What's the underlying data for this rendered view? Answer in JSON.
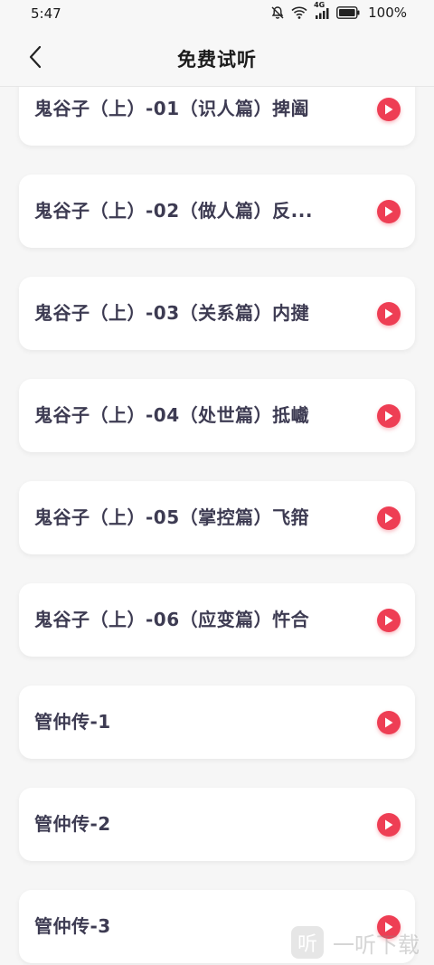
{
  "status_bar": {
    "time": "5:47",
    "network": "4G",
    "battery": "100%"
  },
  "header": {
    "title": "免费试听"
  },
  "episodes": [
    {
      "title": "鬼谷子（上）-01（识人篇）捭阖"
    },
    {
      "title": "鬼谷子（上）-02（做人篇）反..."
    },
    {
      "title": "鬼谷子（上）-03（关系篇）内揵"
    },
    {
      "title": "鬼谷子（上）-04（处世篇）抵巇"
    },
    {
      "title": "鬼谷子（上）-05（掌控篇）飞箝"
    },
    {
      "title": "鬼谷子（上）-06（应变篇）忤合"
    },
    {
      "title": "管仲传-1"
    },
    {
      "title": "管仲传-2"
    },
    {
      "title": "管仲传-3"
    }
  ],
  "watermark": {
    "logo_char": "听",
    "text": "一听下载"
  },
  "colors": {
    "accent": "#ee3e54",
    "title_text": "#3d3b52"
  }
}
